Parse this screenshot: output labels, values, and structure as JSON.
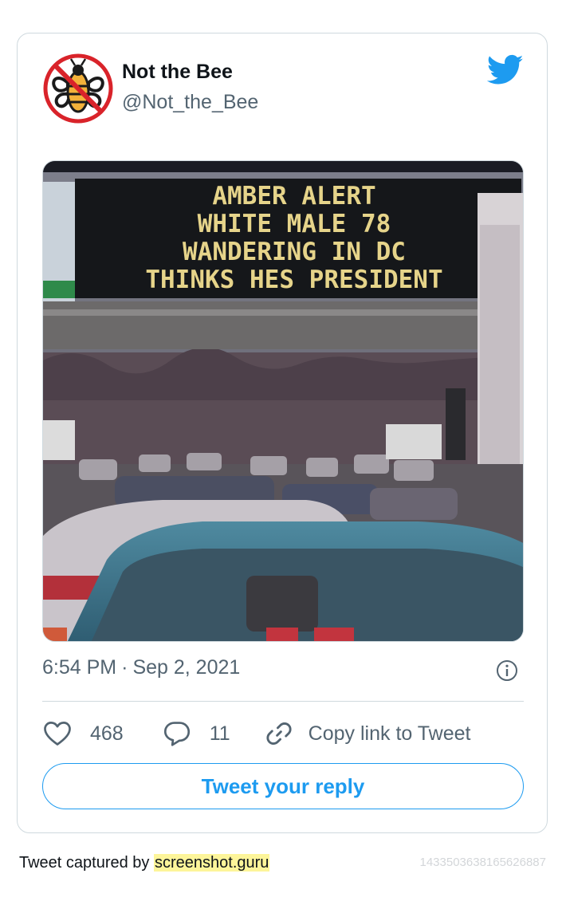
{
  "tweet": {
    "author_name": "Not the Bee",
    "author_handle": "@Not_the_Bee",
    "image_sign_lines": [
      "AMBER ALERT",
      "WHITE MALE 78",
      "WANDERING IN DC",
      "THINKS HES PRESIDENT"
    ],
    "time": "6:54 PM",
    "separator": "·",
    "date": "Sep 2, 2021",
    "likes": "468",
    "replies": "11",
    "copy_link_label": "Copy link to Tweet",
    "reply_button_label": "Tweet your reply"
  },
  "footer": {
    "captured_by": "Tweet captured by",
    "site": "screenshot.guru",
    "tweet_id": "1433503638165626887"
  },
  "icons": {
    "avatar": "no-bee-logo-icon",
    "brand": "twitter-bird-icon",
    "info": "info-icon",
    "like": "heart-icon",
    "reply": "speech-bubble-icon",
    "copy": "link-icon"
  },
  "colors": {
    "accent": "#1d9bf0",
    "secondary_text": "#536471",
    "border": "#cfd9de",
    "sign_text": "#e6d48a",
    "highlight": "#fdf59a"
  }
}
